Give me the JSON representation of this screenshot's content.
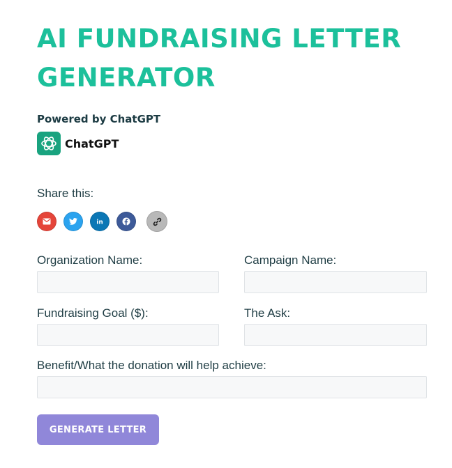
{
  "header": {
    "title": "AI FUNDRAISING LETTER GENERATOR",
    "powered_by": "Powered by ChatGPT",
    "brand_name": "ChatGPT"
  },
  "share": {
    "label": "Share this:",
    "buttons": [
      {
        "name": "email",
        "icon": "envelope-icon",
        "color": "#e5453a"
      },
      {
        "name": "twitter",
        "icon": "twitter-bird-icon",
        "color": "#2ba3ef"
      },
      {
        "name": "linkedin",
        "icon": "linkedin-icon",
        "color": "#0b77b5"
      },
      {
        "name": "facebook",
        "icon": "facebook-icon",
        "color": "#3d5a99"
      },
      {
        "name": "copy-link",
        "icon": "link-icon",
        "color": "#b8b8b8"
      }
    ]
  },
  "form": {
    "organization_name": {
      "label": "Organization Name:",
      "value": "",
      "placeholder": ""
    },
    "campaign_name": {
      "label": "Campaign Name:",
      "value": "",
      "placeholder": ""
    },
    "fundraising_goal": {
      "label": "Fundraising Goal ($):",
      "value": "",
      "placeholder": ""
    },
    "the_ask": {
      "label": "The Ask:",
      "value": "",
      "placeholder": ""
    },
    "benefit": {
      "label": "Benefit/What the donation will help achieve:",
      "value": "",
      "placeholder": ""
    },
    "submit_label": "GENERATE LETTER"
  },
  "colors": {
    "title": "#1cc09b",
    "text": "#1f3d44",
    "button": "#9087d9",
    "chatgpt_brand": "#19a37f",
    "input_bg": "#f7f8f9"
  }
}
